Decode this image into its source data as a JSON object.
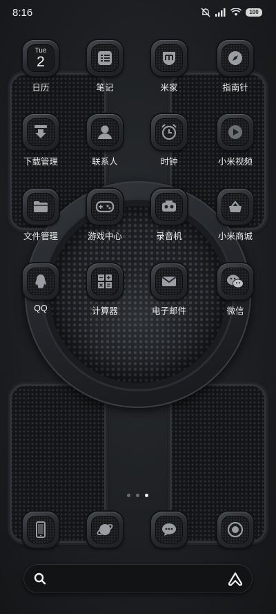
{
  "status_bar": {
    "time": "8:16",
    "battery": "100",
    "icons": [
      "alarm-muted-icon",
      "signal-icon",
      "wifi-icon",
      "battery-icon"
    ]
  },
  "apps": [
    {
      "label": "日历",
      "icon": "calendar-icon",
      "calendar": {
        "day": "Tue",
        "date": "2"
      }
    },
    {
      "label": "笔记",
      "icon": "notes-icon"
    },
    {
      "label": "米家",
      "icon": "mijia-icon"
    },
    {
      "label": "指南针",
      "icon": "compass-icon"
    },
    {
      "label": "下载管理",
      "icon": "download-icon"
    },
    {
      "label": "联系人",
      "icon": "contacts-icon"
    },
    {
      "label": "时钟",
      "icon": "clock-icon"
    },
    {
      "label": "小米视频",
      "icon": "video-icon"
    },
    {
      "label": "文件管理",
      "icon": "folder-icon"
    },
    {
      "label": "游戏中心",
      "icon": "gamepad-icon"
    },
    {
      "label": "录音机",
      "icon": "recorder-icon"
    },
    {
      "label": "小米商城",
      "icon": "store-icon"
    },
    {
      "label": "QQ",
      "icon": "qq-icon"
    },
    {
      "label": "计算器",
      "icon": "calculator-icon"
    },
    {
      "label": "电子邮件",
      "icon": "email-icon"
    },
    {
      "label": "微信",
      "icon": "wechat-icon"
    }
  ],
  "page_indicator": {
    "count": 3,
    "active_index": 2
  },
  "dock": [
    {
      "icon": "phone-device-icon"
    },
    {
      "icon": "browser-planet-icon"
    },
    {
      "icon": "messages-icon"
    },
    {
      "icon": "camera-icon"
    }
  ],
  "search_bar": {
    "left_icon": "search-icon",
    "right_icon": "assistant-icon"
  },
  "colors": {
    "background": "#1e2023",
    "icon_glyph": "#9a9da2",
    "text": "#ececec"
  }
}
